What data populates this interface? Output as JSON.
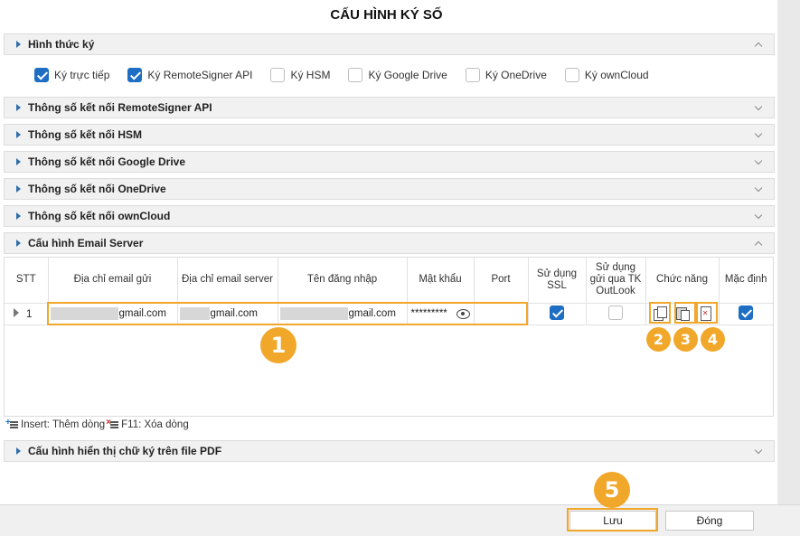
{
  "title": "CẤU HÌNH KÝ SỐ",
  "panels": {
    "sign_type": "Hình thức ký",
    "remote_signer": "Thông số kết nối RemoteSigner API",
    "hsm": "Thông số kết nối HSM",
    "google_drive": "Thông số kết nối Google Drive",
    "onedrive": "Thông số kết nối OneDrive",
    "owncloud": "Thông số kết nối ownCloud",
    "email_server": "Cấu hình Email Server",
    "pdf_display": "Cấu hình hiển thị chữ ký trên file PDF"
  },
  "sign_options": [
    {
      "label": "Ký trực tiếp",
      "checked": true
    },
    {
      "label": "Ký RemoteSigner API",
      "checked": true
    },
    {
      "label": "Ký HSM",
      "checked": false
    },
    {
      "label": "Ký Google Drive",
      "checked": false
    },
    {
      "label": "Ký OneDrive",
      "checked": false
    },
    {
      "label": "Ký ownCloud",
      "checked": false
    }
  ],
  "grid": {
    "headers": {
      "stt": "STT",
      "sender_email": "Địa chỉ email gửi",
      "server_email": "Địa chỉ email server",
      "username": "Tên đăng nhập",
      "password": "Mật khẩu",
      "port": "Port",
      "ssl": "Sử dụng SSL",
      "outlook": "Sử dụng gửi qua TK OutLook",
      "functions": "Chức năng",
      "default": "Mặc định"
    },
    "row": {
      "stt": "1",
      "sender_email": "gmail.com",
      "server_email": "gmail.com",
      "username": "gmail.com",
      "password": "*********",
      "port": "",
      "ssl": true,
      "outlook": false,
      "default": true
    }
  },
  "hints": {
    "insert": "Insert: Thêm dòng",
    "delete": "F11: Xóa dòng"
  },
  "badges": [
    "1",
    "2",
    "3",
    "4",
    "5"
  ],
  "buttons": {
    "save": "Lưu",
    "close": "Đóng"
  },
  "colors": {
    "accent": "#1e6fc4",
    "highlight": "#f1a72a"
  }
}
